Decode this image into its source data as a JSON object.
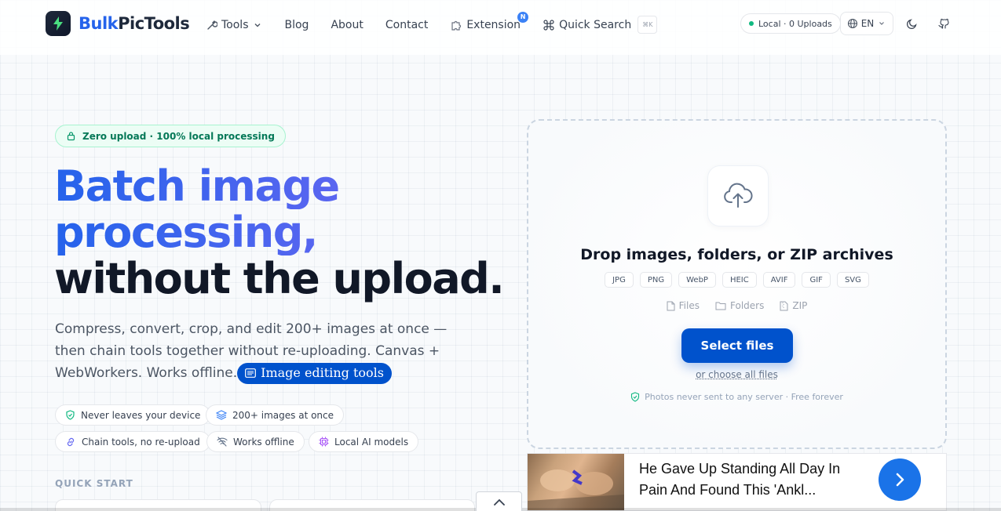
{
  "header": {
    "brand_prefix": "Bulk",
    "brand_suffix": "PicTools",
    "nav": {
      "tools": "Tools",
      "blog": "Blog",
      "about": "About",
      "contact": "Contact",
      "extension": "Extension",
      "extension_badge": "N",
      "quick_search": "Quick Search",
      "quick_search_kbd": "⌘K"
    },
    "status": "Local · 0 Uploads",
    "language": "EN"
  },
  "hero": {
    "badge": "Zero upload · 100% local processing",
    "title_line1": "Batch image",
    "title_line2": "processing,",
    "title_line3": "without the upload.",
    "description": "Compress, convert, crop, and edit 200+ images at once — then chain tools together without re-uploading. Canvas + WebWorkers. Works offline.",
    "inline_tag": "Image editing tools",
    "features": [
      "Never leaves your device",
      "200+ images at once",
      "Chain tools, no re-upload",
      "Works offline",
      "Local AI models"
    ],
    "quick_start_label": "QUICK START"
  },
  "dropzone": {
    "title": "Drop images, folders, or ZIP archives",
    "formats": [
      "JPG",
      "PNG",
      "WebP",
      "HEIC",
      "AVIF",
      "GIF",
      "SVG"
    ],
    "sources": [
      "Files",
      "Folders",
      "ZIP"
    ],
    "select_button": "Select files",
    "choose_all": "or choose all files",
    "privacy": "Photos never sent to any server · Free forever"
  },
  "ad": {
    "title": "He Gave Up Standing All Day In Pain And Found This 'Ankl..."
  },
  "colors": {
    "primary": "#0052cc",
    "brand_blue": "#2563eb",
    "success": "#10b981"
  }
}
